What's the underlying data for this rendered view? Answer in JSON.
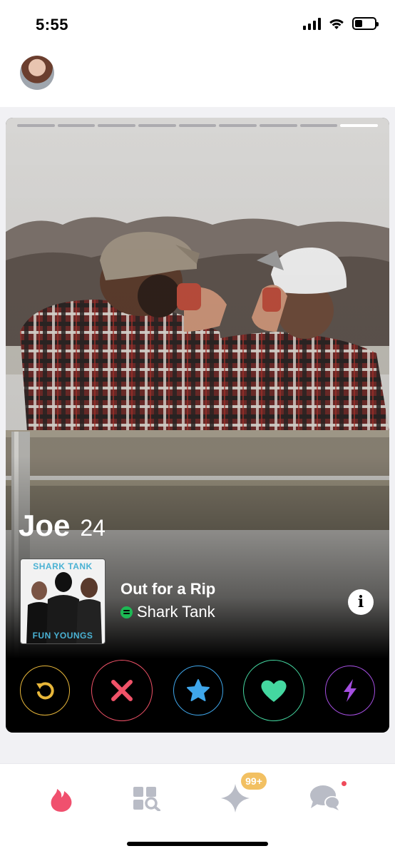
{
  "status": {
    "time": "5:55",
    "battery_level": 0.4
  },
  "card": {
    "photo_count": 9,
    "active_photo": 9,
    "name": "Joe",
    "age": "24"
  },
  "anthem": {
    "album_top": "SHARK TANK",
    "album_bottom": "FUN YOUNGS",
    "title": "Out for a Rip",
    "artist": "Shark Tank",
    "service_icon": "spotify-icon"
  },
  "actions": [
    {
      "name": "rewind-icon",
      "color": "#e8b73a"
    },
    {
      "name": "nope-icon",
      "color": "#f05268"
    },
    {
      "name": "super-like-icon",
      "color": "#3fa6ea"
    },
    {
      "name": "like-icon",
      "color": "#44d7a0"
    },
    {
      "name": "boost-icon",
      "color": "#a44ee0"
    }
  ],
  "tabs": [
    {
      "name": "flame-icon",
      "active": true,
      "color": "#f0506e"
    },
    {
      "name": "discover-icon",
      "active": false
    },
    {
      "name": "gold-icon",
      "active": false,
      "badge": "99+"
    },
    {
      "name": "messages-icon",
      "active": false,
      "has_unread": true
    }
  ]
}
